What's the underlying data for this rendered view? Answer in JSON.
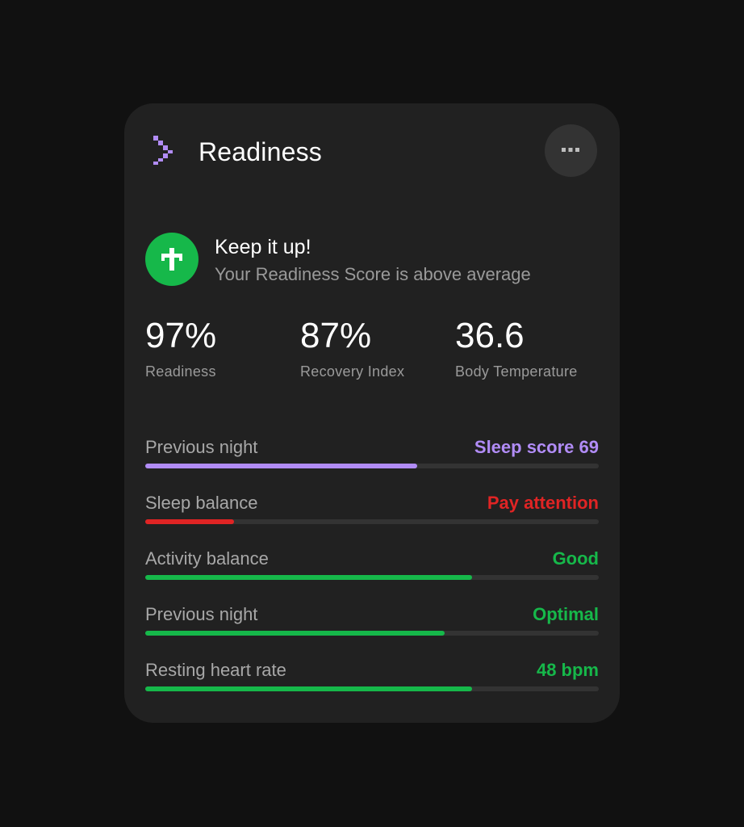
{
  "header": {
    "title": "Readiness",
    "logo_icon": "chevron-pixel-logo",
    "more_icon": "more-horizontal-icon"
  },
  "status": {
    "icon": "cross-icon",
    "title": "Keep it up!",
    "subtitle": "Your Readiness Score is above average"
  },
  "metrics": [
    {
      "value": "97%",
      "label": "Readiness"
    },
    {
      "value": "87%",
      "label": "Recovery Index"
    },
    {
      "value": "36.6",
      "label": "Body Temperature"
    }
  ],
  "rows": [
    {
      "label": "Previous night",
      "value": "Sleep score 69",
      "color": "#b18cf6",
      "progress": 0.6
    },
    {
      "label": "Sleep balance",
      "value": "Pay attention",
      "color": "#e02424",
      "progress": 0.195
    },
    {
      "label": "Activity balance",
      "value": "Good",
      "color": "#16b84a",
      "progress": 0.72
    },
    {
      "label": "Previous night",
      "value": "Optimal",
      "color": "#16b84a",
      "progress": 0.66
    },
    {
      "label": "Resting heart rate",
      "value": "48 bpm",
      "color": "#16b84a",
      "progress": 0.72
    }
  ],
  "colors": {
    "accent_purple": "#b18cf6",
    "good_green": "#16b84a",
    "warning_red": "#e02424"
  }
}
